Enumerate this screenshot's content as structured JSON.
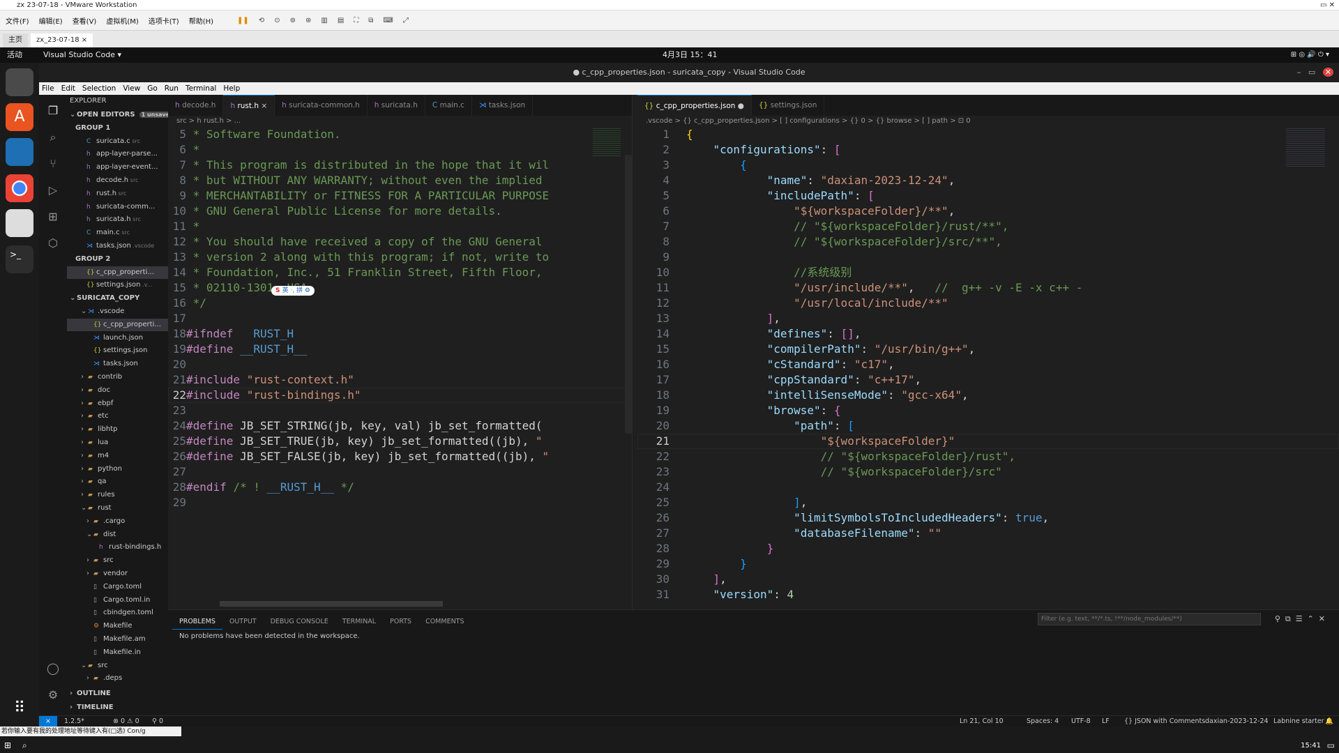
{
  "vmware": {
    "title": "zx 23-07-18 - VMware Workstation",
    "menu": [
      "文件(F)",
      "编辑(E)",
      "查看(V)",
      "虚拟机(M)",
      "选项卡(T)",
      "帮助(H)"
    ],
    "tabs": [
      {
        "label": "主页"
      },
      {
        "label": "zx_23-07-18"
      }
    ]
  },
  "gnome": {
    "activities": "活动",
    "app": "Visual Studio Code ▾",
    "clock": "4月3日 15：41"
  },
  "vscode": {
    "title": "● c_cpp_properties.json - suricata_copy - Visual Studio Code",
    "menu": [
      "File",
      "Edit",
      "Selection",
      "View",
      "Go",
      "Run",
      "Terminal",
      "Help"
    ]
  },
  "explorer": {
    "title": "EXPLORER",
    "open_editors": "OPEN EDITORS",
    "unsaved": "1 unsaved",
    "group1": "GROUP 1",
    "group1_items": [
      {
        "icon": "C",
        "name": "suricata.c",
        "desc": "src"
      },
      {
        "icon": "h",
        "name": "app-layer-parse...",
        "desc": ""
      },
      {
        "icon": "h",
        "name": "app-layer-event...",
        "desc": ""
      },
      {
        "icon": "h",
        "name": "decode.h",
        "desc": "src"
      },
      {
        "icon": "h",
        "name": "rust.h",
        "desc": "src"
      },
      {
        "icon": "h",
        "name": "suricata-comm...",
        "desc": ""
      },
      {
        "icon": "h",
        "name": "suricata.h",
        "desc": "src"
      },
      {
        "icon": "C",
        "name": "main.c",
        "desc": "src"
      },
      {
        "icon": "vs",
        "name": "tasks.json",
        "desc": ".vscode"
      }
    ],
    "group2": "GROUP 2",
    "group2_items": [
      {
        "icon": "{}",
        "name": "c_cpp_properti...",
        "desc": ""
      },
      {
        "icon": "{}",
        "name": "settings.json",
        "desc": ".v..."
      }
    ],
    "project": "SURICATA_COPY",
    "tree": [
      {
        "depth": 1,
        "arrow": "v",
        "icon": "vs",
        "name": ".vscode"
      },
      {
        "depth": 2,
        "arrow": "",
        "icon": "{}",
        "name": "c_cpp_properti...",
        "sel": true
      },
      {
        "depth": 2,
        "arrow": "",
        "icon": "vs",
        "name": "launch.json"
      },
      {
        "depth": 2,
        "arrow": "",
        "icon": "{}",
        "name": "settings.json"
      },
      {
        "depth": 2,
        "arrow": "",
        "icon": "vs",
        "name": "tasks.json"
      },
      {
        "depth": 1,
        "arrow": ">",
        "icon": "folder",
        "name": "contrib"
      },
      {
        "depth": 1,
        "arrow": ">",
        "icon": "folder",
        "name": "doc"
      },
      {
        "depth": 1,
        "arrow": ">",
        "icon": "folder",
        "name": "ebpf"
      },
      {
        "depth": 1,
        "arrow": ">",
        "icon": "folder",
        "name": "etc"
      },
      {
        "depth": 1,
        "arrow": ">",
        "icon": "folder",
        "name": "libhtp"
      },
      {
        "depth": 1,
        "arrow": ">",
        "icon": "folder",
        "name": "lua"
      },
      {
        "depth": 1,
        "arrow": ">",
        "icon": "folder",
        "name": "m4"
      },
      {
        "depth": 1,
        "arrow": ">",
        "icon": "folder",
        "name": "python"
      },
      {
        "depth": 1,
        "arrow": ">",
        "icon": "folder",
        "name": "qa"
      },
      {
        "depth": 1,
        "arrow": ">",
        "icon": "folder",
        "name": "rules"
      },
      {
        "depth": 1,
        "arrow": "v",
        "icon": "folder",
        "name": "rust"
      },
      {
        "depth": 2,
        "arrow": ">",
        "icon": "folder",
        "name": ".cargo"
      },
      {
        "depth": 2,
        "arrow": "v",
        "icon": "folder",
        "name": "dist"
      },
      {
        "depth": 3,
        "arrow": "",
        "icon": "h",
        "name": "rust-bindings.h"
      },
      {
        "depth": 2,
        "arrow": ">",
        "icon": "folder",
        "name": "src"
      },
      {
        "depth": 2,
        "arrow": ">",
        "icon": "folder",
        "name": "vendor"
      },
      {
        "depth": 2,
        "arrow": "",
        "icon": "file",
        "name": "Cargo.toml"
      },
      {
        "depth": 2,
        "arrow": "",
        "icon": "file",
        "name": "Cargo.toml.in"
      },
      {
        "depth": 2,
        "arrow": "",
        "icon": "file",
        "name": "cbindgen.toml"
      },
      {
        "depth": 2,
        "arrow": "",
        "icon": "mk",
        "name": "Makefile"
      },
      {
        "depth": 2,
        "arrow": "",
        "icon": "file",
        "name": "Makefile.am"
      },
      {
        "depth": 2,
        "arrow": "",
        "icon": "file",
        "name": "Makefile.in"
      },
      {
        "depth": 1,
        "arrow": "v",
        "icon": "folder",
        "name": "src"
      },
      {
        "depth": 2,
        "arrow": ">",
        "icon": "folder",
        "name": ".deps"
      }
    ],
    "outline": "OUTLINE",
    "timeline": "TIMELINE"
  },
  "left_editor": {
    "tabs": [
      "decode.h",
      "rust.h",
      "suricata-common.h",
      "suricata.h",
      "main.c",
      "tasks.json"
    ],
    "tab_icons": [
      "h",
      "h",
      "h",
      "h",
      "C",
      "vs"
    ],
    "active_tab": 1,
    "breadcrumb": "src > h rust.h > ...",
    "lines": [
      {
        "n": 5,
        "t": [
          [
            "c-com",
            " * Software Foundation."
          ]
        ]
      },
      {
        "n": 6,
        "t": [
          [
            "c-com",
            " *"
          ]
        ]
      },
      {
        "n": 7,
        "t": [
          [
            "c-com",
            " * This program is distributed in the hope that it wil"
          ]
        ]
      },
      {
        "n": 8,
        "t": [
          [
            "c-com",
            " * but WITHOUT ANY WARRANTY; without even the implied"
          ]
        ]
      },
      {
        "n": 9,
        "t": [
          [
            "c-com",
            " * MERCHANTABILITY or FITNESS FOR A PARTICULAR PURPOSE"
          ]
        ]
      },
      {
        "n": 10,
        "t": [
          [
            "c-com",
            " * GNU General Public License for more details."
          ]
        ]
      },
      {
        "n": 11,
        "t": [
          [
            "c-com",
            " *"
          ]
        ]
      },
      {
        "n": 12,
        "t": [
          [
            "c-com",
            " * You should have received a copy of the GNU General"
          ]
        ]
      },
      {
        "n": 13,
        "t": [
          [
            "c-com",
            " * version 2 along with this program; if not, write to"
          ]
        ]
      },
      {
        "n": 14,
        "t": [
          [
            "c-com",
            " * Foundation, Inc., 51 Franklin Street, Fifth Floor,"
          ]
        ]
      },
      {
        "n": 15,
        "t": [
          [
            "c-com",
            " * 02110-1301, USA."
          ]
        ]
      },
      {
        "n": 16,
        "t": [
          [
            "c-com",
            " */"
          ]
        ]
      },
      {
        "n": 17,
        "t": []
      },
      {
        "n": 18,
        "t": [
          [
            "c-mac",
            "#ifndef"
          ],
          [
            "c-p",
            "   "
          ],
          [
            "c-kw",
            "RUST_H"
          ]
        ]
      },
      {
        "n": 19,
        "t": [
          [
            "c-mac",
            "#define"
          ],
          [
            "c-p",
            " "
          ],
          [
            "c-kw",
            "__RUST_H__"
          ]
        ]
      },
      {
        "n": 20,
        "t": []
      },
      {
        "n": 21,
        "t": [
          [
            "c-mac",
            "#include"
          ],
          [
            "c-p",
            " "
          ],
          [
            "c-str",
            "\"rust-context.h\""
          ]
        ]
      },
      {
        "n": 22,
        "t": [
          [
            "c-mac",
            "#include"
          ],
          [
            "c-p",
            " "
          ],
          [
            "c-str",
            "\"rust-bindings.h\""
          ]
        ]
      },
      {
        "n": 23,
        "t": []
      },
      {
        "n": 24,
        "t": [
          [
            "c-mac",
            "#define"
          ],
          [
            "c-p",
            " JB_SET_STRING(jb, key, val) jb_set_formatted("
          ]
        ]
      },
      {
        "n": 25,
        "t": [
          [
            "c-mac",
            "#define"
          ],
          [
            "c-p",
            " JB_SET_TRUE(jb, key) jb_set_formatted((jb), "
          ],
          [
            "c-str",
            "\""
          ]
        ]
      },
      {
        "n": 26,
        "t": [
          [
            "c-mac",
            "#define"
          ],
          [
            "c-p",
            " JB_SET_FALSE(jb, key) jb_set_formatted((jb), "
          ],
          [
            "c-str",
            "\""
          ]
        ]
      },
      {
        "n": 27,
        "t": []
      },
      {
        "n": 28,
        "t": [
          [
            "c-mac",
            "#endif"
          ],
          [
            "c-com",
            " /* ! "
          ],
          [
            "c-kw",
            "__RUST_H__"
          ],
          [
            "c-com",
            " */"
          ]
        ]
      },
      {
        "n": 29,
        "t": []
      }
    ],
    "active_line": 22,
    "ime_label": "英 ·, 拼 ⚙"
  },
  "right_editor": {
    "tabs": [
      "c_cpp_properties.json",
      "settings.json"
    ],
    "active_tab": 0,
    "breadcrumb": ".vscode > {} c_cpp_properties.json > [ ] configurations > {} 0 > {} browse > [ ] path > ⊡ 0",
    "lines": [
      {
        "n": 1,
        "t": [
          [
            "c-y",
            "{"
          ]
        ]
      },
      {
        "n": 2,
        "t": [
          [
            "c-p",
            "    "
          ],
          [
            "c-key",
            "\"configurations\""
          ],
          [
            "c-p",
            ": "
          ],
          [
            "c-b",
            "["
          ]
        ]
      },
      {
        "n": 3,
        "t": [
          [
            "c-p",
            "        "
          ],
          [
            "c-bb",
            "{"
          ]
        ]
      },
      {
        "n": 4,
        "t": [
          [
            "c-p",
            "            "
          ],
          [
            "c-key",
            "\"name\""
          ],
          [
            "c-p",
            ": "
          ],
          [
            "c-str",
            "\"daxian-2023-12-24\""
          ],
          [
            "c-p",
            ","
          ]
        ]
      },
      {
        "n": 5,
        "t": [
          [
            "c-p",
            "            "
          ],
          [
            "c-key",
            "\"includePath\""
          ],
          [
            "c-p",
            ": "
          ],
          [
            "c-b",
            "["
          ]
        ]
      },
      {
        "n": 6,
        "t": [
          [
            "c-p",
            "                "
          ],
          [
            "c-str",
            "\"${workspaceFolder}/**\""
          ],
          [
            "c-p",
            ","
          ]
        ]
      },
      {
        "n": 7,
        "t": [
          [
            "c-p",
            "                "
          ],
          [
            "c-com",
            "// \"${workspaceFolder}/rust/**\","
          ]
        ]
      },
      {
        "n": 8,
        "t": [
          [
            "c-p",
            "                "
          ],
          [
            "c-com",
            "// \"${workspaceFolder}/src/**\","
          ]
        ]
      },
      {
        "n": 9,
        "t": []
      },
      {
        "n": 10,
        "t": [
          [
            "c-p",
            "                "
          ],
          [
            "c-com",
            "//系统级别"
          ]
        ]
      },
      {
        "n": 11,
        "t": [
          [
            "c-p",
            "                "
          ],
          [
            "c-str",
            "\"/usr/include/**\""
          ],
          [
            "c-p",
            ",   "
          ],
          [
            "c-com",
            "//  g++ -v -E -x c++ -"
          ]
        ]
      },
      {
        "n": 12,
        "t": [
          [
            "c-p",
            "                "
          ],
          [
            "c-str",
            "\"/usr/local/include/**\""
          ]
        ]
      },
      {
        "n": 13,
        "t": [
          [
            "c-p",
            "            "
          ],
          [
            "c-b",
            "]"
          ],
          [
            "c-p",
            ","
          ]
        ]
      },
      {
        "n": 14,
        "t": [
          [
            "c-p",
            "            "
          ],
          [
            "c-key",
            "\"defines\""
          ],
          [
            "c-p",
            ": "
          ],
          [
            "c-b",
            "[]"
          ],
          [
            "c-p",
            ","
          ]
        ]
      },
      {
        "n": 15,
        "t": [
          [
            "c-p",
            "            "
          ],
          [
            "c-key",
            "\"compilerPath\""
          ],
          [
            "c-p",
            ": "
          ],
          [
            "c-str",
            "\"/usr/bin/g++\""
          ],
          [
            "c-p",
            ","
          ]
        ]
      },
      {
        "n": 16,
        "t": [
          [
            "c-p",
            "            "
          ],
          [
            "c-key",
            "\"cStandard\""
          ],
          [
            "c-p",
            ": "
          ],
          [
            "c-str",
            "\"c17\""
          ],
          [
            "c-p",
            ","
          ]
        ]
      },
      {
        "n": 17,
        "t": [
          [
            "c-p",
            "            "
          ],
          [
            "c-key",
            "\"cppStandard\""
          ],
          [
            "c-p",
            ": "
          ],
          [
            "c-str",
            "\"c++17\""
          ],
          [
            "c-p",
            ","
          ]
        ]
      },
      {
        "n": 18,
        "t": [
          [
            "c-p",
            "            "
          ],
          [
            "c-key",
            "\"intelliSenseMode\""
          ],
          [
            "c-p",
            ": "
          ],
          [
            "c-str",
            "\"gcc-x64\""
          ],
          [
            "c-p",
            ","
          ]
        ]
      },
      {
        "n": 19,
        "t": [
          [
            "c-p",
            "            "
          ],
          [
            "c-key",
            "\"browse\""
          ],
          [
            "c-p",
            ": "
          ],
          [
            "c-b",
            "{"
          ]
        ]
      },
      {
        "n": 20,
        "t": [
          [
            "c-p",
            "                "
          ],
          [
            "c-key",
            "\"path\""
          ],
          [
            "c-p",
            ": "
          ],
          [
            "c-bb",
            "["
          ]
        ]
      },
      {
        "n": 21,
        "t": [
          [
            "c-p",
            "                    "
          ],
          [
            "c-str",
            "\"${workspaceFolder}\""
          ]
        ]
      },
      {
        "n": 22,
        "t": [
          [
            "c-p",
            "                    "
          ],
          [
            "c-com",
            "// \"${workspaceFolder}/rust\","
          ]
        ]
      },
      {
        "n": 23,
        "t": [
          [
            "c-p",
            "                    "
          ],
          [
            "c-com",
            "// \"${workspaceFolder}/src\""
          ]
        ]
      },
      {
        "n": 24,
        "t": []
      },
      {
        "n": 25,
        "t": [
          [
            "c-p",
            "                "
          ],
          [
            "c-bb",
            "]"
          ],
          [
            "c-p",
            ","
          ]
        ]
      },
      {
        "n": 26,
        "t": [
          [
            "c-p",
            "                "
          ],
          [
            "c-key",
            "\"limitSymbolsToIncludedHeaders\""
          ],
          [
            "c-p",
            ": "
          ],
          [
            "c-kw",
            "true"
          ],
          [
            "c-p",
            ","
          ]
        ]
      },
      {
        "n": 27,
        "t": [
          [
            "c-p",
            "                "
          ],
          [
            "c-key",
            "\"databaseFilename\""
          ],
          [
            "c-p",
            ": "
          ],
          [
            "c-str",
            "\"\""
          ]
        ]
      },
      {
        "n": 28,
        "t": [
          [
            "c-p",
            "            "
          ],
          [
            "c-b",
            "}"
          ]
        ]
      },
      {
        "n": 29,
        "t": [
          [
            "c-p",
            "        "
          ],
          [
            "c-bb",
            "}"
          ]
        ]
      },
      {
        "n": 30,
        "t": [
          [
            "c-p",
            "    "
          ],
          [
            "c-b",
            "]"
          ],
          [
            "c-p",
            ","
          ]
        ]
      },
      {
        "n": 31,
        "t": [
          [
            "c-p",
            "    "
          ],
          [
            "c-key",
            "\"version\""
          ],
          [
            "c-p",
            ": "
          ],
          [
            "c-num",
            "4"
          ]
        ]
      }
    ],
    "active_line": 21
  },
  "panel": {
    "tabs": [
      "PROBLEMS",
      "OUTPUT",
      "DEBUG CONSOLE",
      "TERMINAL",
      "PORTS",
      "COMMENTS"
    ],
    "message": "No problems have been detected in the workspace.",
    "filter_placeholder": "Filter (e.g. text, **/*.ts, !**/node_modules/**)"
  },
  "status": {
    "remote": "⨯",
    "version": "1.2.5*",
    "errors": "⊗ 0 ⚠ 0",
    "ports": "⚲ 0",
    "position": "Ln 21, Col 10",
    "spaces": "Spaces: 4",
    "encoding": "UTF-8",
    "eol": "LF",
    "language": "{} JSON with Comments",
    "config": "daxian-2023-12-24",
    "walkthrough": "Labnine starter"
  },
  "taskbar": {
    "ime_hint": "若你输入要有我的处理地址等待键入有(□选) Con/g",
    "clock": "15:41"
  }
}
